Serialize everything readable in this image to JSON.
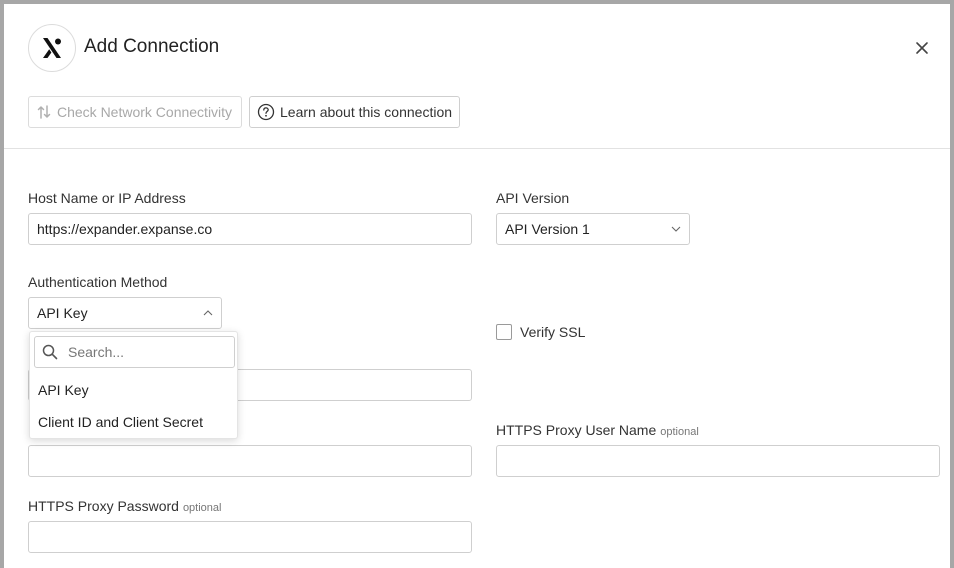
{
  "dialog": {
    "title": "Add Connection"
  },
  "toolbar": {
    "check_network_label": "Check Network Connectivity",
    "learn_label": "Learn about this connection"
  },
  "fields": {
    "host": {
      "label": "Host Name or IP Address",
      "value": "https://expander.expanse.co"
    },
    "api_version": {
      "label": "API Version",
      "value": "API Version 1"
    },
    "auth_method": {
      "label": "Authentication Method",
      "value": "API Key"
    },
    "verify_ssl": {
      "label": "Verify SSL",
      "checked": false
    },
    "proxy_user": {
      "label": "HTTPS Proxy User Name",
      "optional": "optional",
      "value": ""
    },
    "proxy_password": {
      "label": "HTTPS Proxy Password",
      "optional": "optional",
      "value": ""
    }
  },
  "dropdown": {
    "search_placeholder": "Search...",
    "options": [
      "API Key",
      "Client ID and Client Secret"
    ]
  },
  "colors": {
    "border": "#cfcfcf",
    "text": "#222222",
    "disabled": "#a8a8a8"
  }
}
